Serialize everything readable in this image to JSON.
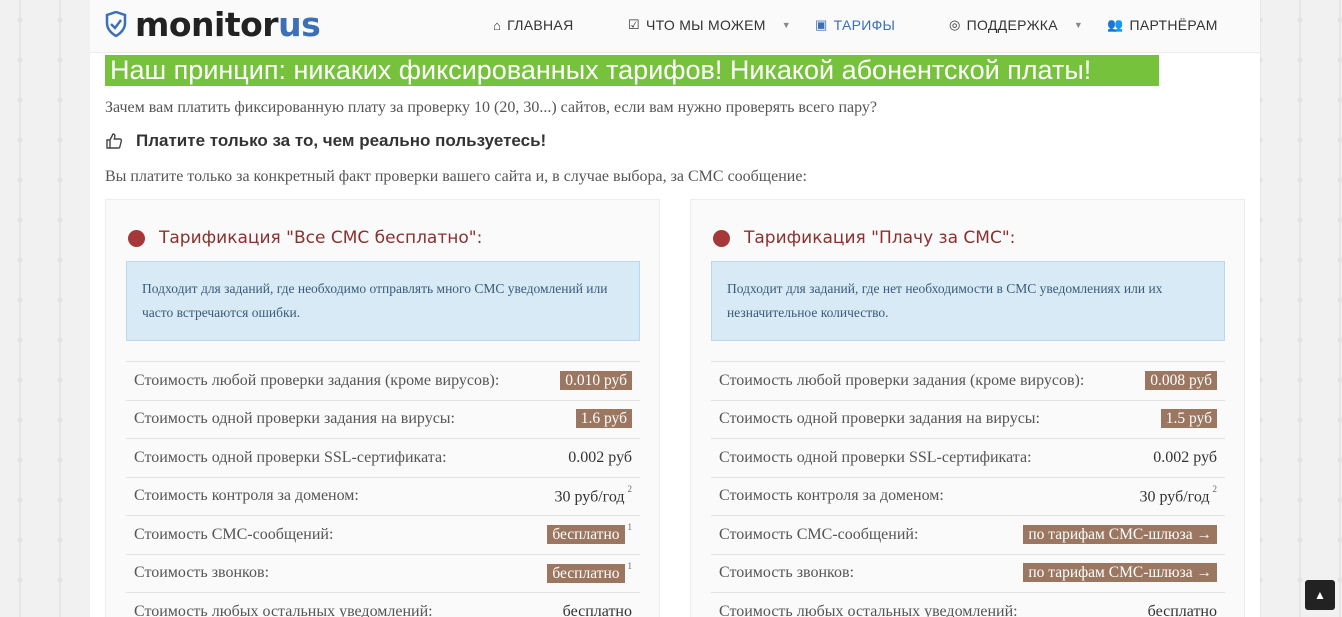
{
  "header": {
    "logo_main": "monitor",
    "logo_accent": "us",
    "nav": [
      {
        "icon": "home-icon",
        "glyph": "⌂",
        "label": "ГЛАВНАЯ"
      },
      {
        "icon": "checkbox-icon",
        "glyph": "☑",
        "label": "ЧТО МЫ МОЖЕМ"
      },
      {
        "icon": "money-icon",
        "glyph": "▣",
        "label": "ТАРИФЫ"
      },
      {
        "icon": "lifebuoy-icon",
        "glyph": "◎",
        "label": "ПОДДЕРЖКА"
      },
      {
        "icon": "users-icon",
        "glyph": "👥",
        "label": "ПАРТНЁРАМ"
      }
    ]
  },
  "content": {
    "headline": "Наш принцип: никаких фиксированных тарифов! Никакой абонентской платы!",
    "intro": "Зачем вам платить фиксированную плату за проверку 10 (20, 30...) сайтов, если вам нужно проверять всего пару?",
    "subhead": "Платите только за то, чем реально пользуетесь!",
    "intro2": "Вы платите только за конкретный факт проверки вашего сайта и, в случае выбора, за СМС сообщение:"
  },
  "cards": [
    {
      "title": "Тарификация \"Все СМС бесплатно\":",
      "note": "Подходит для заданий, где необходимо отправлять много СМС уведомлений или часто встречаются ошибки.",
      "rows": [
        {
          "label": "Стоимость любой проверки задания (кроме вирусов):",
          "value": "0.010 руб",
          "badge": true,
          "sup": ""
        },
        {
          "label": "Стоимость одной проверки задания на вирусы:",
          "value": "1.6 руб",
          "badge": true,
          "sup": ""
        },
        {
          "label": "Стоимость одной проверки SSL-сертификата:",
          "value": "0.002 руб",
          "badge": false,
          "sup": ""
        },
        {
          "label": "Стоимость контроля за доменом:",
          "value": "30 руб/год",
          "badge": false,
          "sup": "2"
        },
        {
          "label": "Стоимость СМС-сообщений:",
          "value": "бесплатно",
          "badge": true,
          "sup": "1"
        },
        {
          "label": "Стоимость звонков:",
          "value": "бесплатно",
          "badge": true,
          "sup": "1"
        },
        {
          "label": "Стоимость любых остальных уведомлений:",
          "value": "бесплатно",
          "badge": false,
          "sup": ""
        }
      ]
    },
    {
      "title": "Тарификация \"Плачу за СМС\":",
      "note": "Подходит для заданий, где нет необходимости в СМС уведомлениях или их незначительное количество.",
      "rows": [
        {
          "label": "Стоимость любой проверки задания (кроме вирусов):",
          "value": "0.008 руб",
          "badge": true,
          "sup": ""
        },
        {
          "label": "Стоимость одной проверки задания на вирусы:",
          "value": "1.5 руб",
          "badge": true,
          "sup": ""
        },
        {
          "label": "Стоимость одной проверки SSL-сертификата:",
          "value": "0.002 руб",
          "badge": false,
          "sup": ""
        },
        {
          "label": "Стоимость контроля за доменом:",
          "value": "30 руб/год",
          "badge": false,
          "sup": "2"
        },
        {
          "label": "Стоимость СМС-сообщений:",
          "value": "по тарифам СМС-шлюза →",
          "badge": true,
          "sup": ""
        },
        {
          "label": "Стоимость звонков:",
          "value": "по тарифам СМС-шлюза →",
          "badge": true,
          "sup": ""
        },
        {
          "label": "Стоимость любых остальных уведомлений:",
          "value": "бесплатно",
          "badge": false,
          "sup": ""
        }
      ]
    }
  ],
  "colors": {
    "accent_green": "#77c23d",
    "brand_blue": "#3b6fb6",
    "badge_brown": "#9b7660",
    "title_red": "#a53838"
  }
}
